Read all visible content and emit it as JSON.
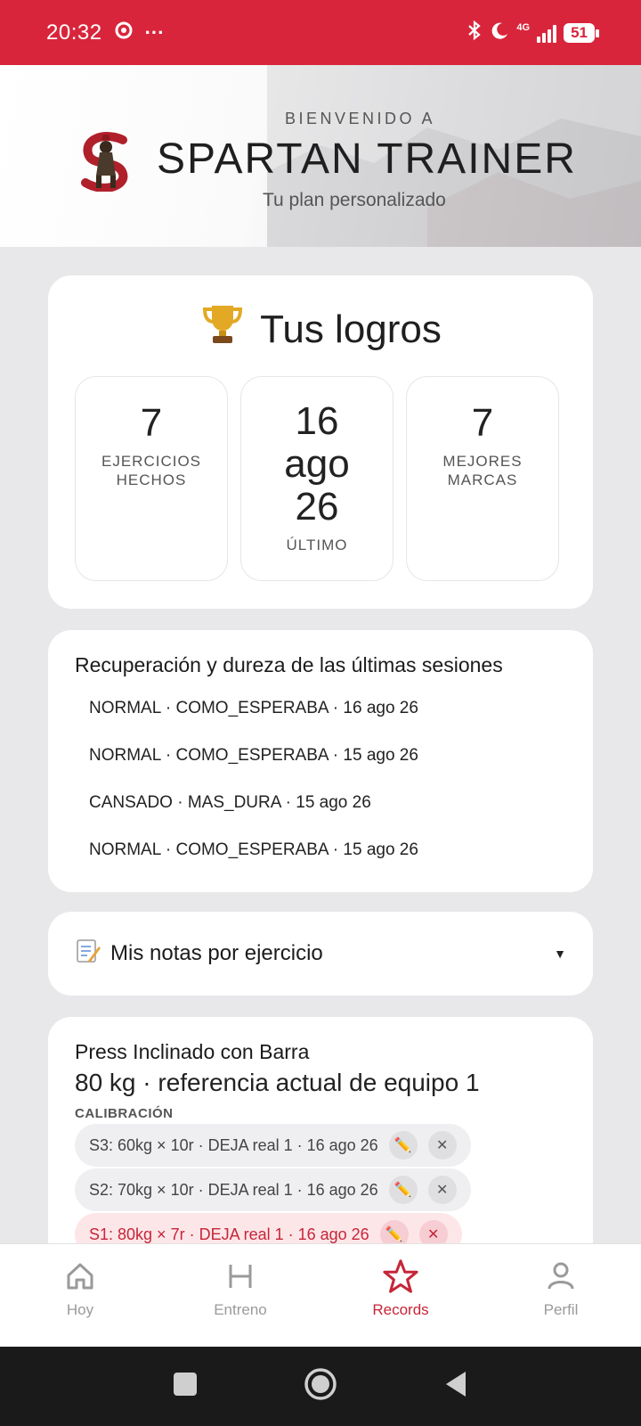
{
  "status_bar": {
    "time": "20:32",
    "more": "···",
    "network": "4G",
    "battery": "51"
  },
  "header": {
    "kicker": "BIENVENIDO A",
    "title": "SPARTAN TRAINER",
    "subtitle": "Tu plan personalizado"
  },
  "logros": {
    "title": "Tus logros",
    "stats": [
      {
        "value": "7",
        "label": "EJERCICIOS\nHECHOS"
      },
      {
        "value": "16\nago\n26",
        "label": "ÚLTIMO"
      },
      {
        "value": "7",
        "label": "MEJORES\nMARCAS"
      }
    ]
  },
  "recuperacion": {
    "title": "Recuperación y dureza de las últimas sesiones",
    "items": [
      "NORMAL · COMO_ESPERABA · 16 ago 26",
      "NORMAL · COMO_ESPERABA · 15 ago 26",
      "CANSADO · MAS_DURA · 15 ago 26",
      "NORMAL · COMO_ESPERABA · 15 ago 26"
    ]
  },
  "notas": {
    "title": "Mis notas por ejercicio",
    "icon": "memo-icon",
    "arrow": "▼"
  },
  "exercise": {
    "title": "Press Inclinado con Barra",
    "reference": "80 kg · referencia actual de equipo 1",
    "section": "CALIBRACIÓN",
    "sets": [
      {
        "label": "S3: 60kg × 10r · DEJA real 1 · 16 ago 26"
      },
      {
        "label": "S2: 70kg × 10r · DEJA real 1 · 16 ago 26"
      },
      {
        "label": "S1: 80kg × 7r · DEJA real 1 · 16 ago 26"
      }
    ]
  },
  "bottom_nav": {
    "items": [
      {
        "label": "Hoy",
        "icon": "home-icon"
      },
      {
        "label": "Entreno",
        "icon": "h-icon"
      },
      {
        "label": "Records",
        "icon": "star-icon"
      },
      {
        "label": "Perfil",
        "icon": "person-icon"
      }
    ]
  },
  "colors": {
    "brand_red": "#d9253b",
    "accent_red": "#c62538",
    "background": "#e8e8ea"
  }
}
